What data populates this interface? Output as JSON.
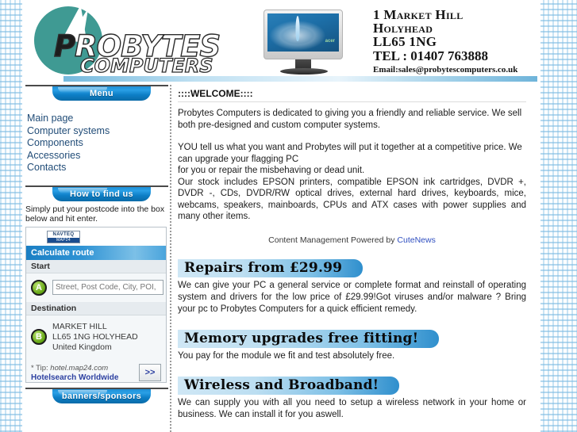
{
  "header": {
    "logo_primary_p": "P",
    "logo_primary_rest": "ROBYTES",
    "logo_secondary": "COMPUTERS",
    "monitor_brand": "acer",
    "address_line1": "1 Market Hill",
    "address_line2": "Holyhead",
    "address_line3": "LL65 1NG",
    "address_tel": "TEL : 01407 763888",
    "address_email": "Email:sales@probytescomputers.co.uk"
  },
  "sidebar": {
    "menu_title": "Menu",
    "menu_items": [
      {
        "label": "Main page"
      },
      {
        "label": "Computer systems"
      },
      {
        "label": "Components"
      },
      {
        "label": "Accessories"
      },
      {
        "label": "Contacts"
      }
    ],
    "howto_title": "How to find us",
    "howto_text": "Simply put your postcode into the box below and hit enter.",
    "map24": {
      "navteq_top": "NAVTEQ",
      "navteq_bottom": "MAP24",
      "calculate_route": "Calculate route",
      "start_label": "Start",
      "start_pin": "A",
      "start_placeholder": "Street, Post Code, City, POI,",
      "start_value": "",
      "destination_label": "Destination",
      "destination_pin": "B",
      "destination_line1": "MARKET HILL",
      "destination_line2": "LL65 1NG HOLYHEAD",
      "destination_line3": "United Kingdom",
      "tip_label": "* Tip:",
      "tip_value": "hotel.map24.com",
      "tip_link": "Hotelsearch Worldwide",
      "go_button": ">>"
    },
    "banners_title": "banners/sponsors"
  },
  "main": {
    "welcome_title": "::::WELCOME::::",
    "paragraph1": "Probytes Computers is dedicated to giving you a friendly and reliable service. We sell both pre-designed and custom computer systems.",
    "paragraph2": "YOU tell us what you want and Probytes will put it together at a competitive price. We can upgrade your flagging PC",
    "paragraph3": "for you or repair the misbehaving or dead unit.",
    "paragraph4": "Our stock includes EPSON printers, compatible EPSON ink cartridges, DVDR +, DVDR -, CDs, DVDR/RW optical drives, external hard drives, keyboards, mice, webcams, speakers, mainboards, CPUs and ATX cases with power supplies and many other items.",
    "cute_prefix": "Content Management Powered by ",
    "cute_link": "CuteNews",
    "promos": [
      {
        "heading": "Repairs from £29.99",
        "body": "We can give your PC a general service or complete format and reinstall of operating system and drivers for the low price of £29.99!Got viruses and/or malware ? Bring your pc to Probytes Computers for a quick efficient remedy."
      },
      {
        "heading": "Memory upgrades free fitting!",
        "body": "You pay for the module we fit and test absolutely free."
      },
      {
        "heading": "Wireless and Broadband!",
        "body": "We can supply you with all you need to setup a wireless network in your home or business. We can install it for you aswell."
      }
    ]
  },
  "colors": {
    "brand_teal": "#3f9a93",
    "brand_blue": "#1b7fc4",
    "link_blue": "#224d78",
    "pin_green": "#63a513"
  }
}
